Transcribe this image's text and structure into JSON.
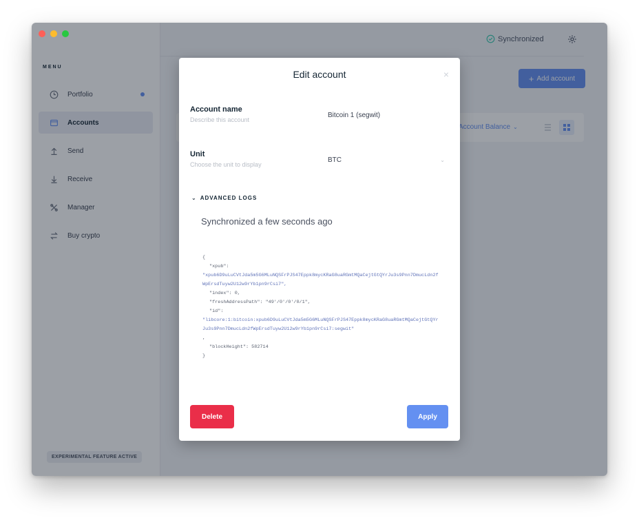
{
  "sidebar": {
    "menu_title": "MENU",
    "items": [
      {
        "label": "Portfolio",
        "icon": "clock-icon"
      },
      {
        "label": "Accounts",
        "icon": "wallet-icon"
      },
      {
        "label": "Send",
        "icon": "arrow-up-icon"
      },
      {
        "label": "Receive",
        "icon": "arrow-down-icon"
      },
      {
        "label": "Manager",
        "icon": "tools-icon"
      },
      {
        "label": "Buy crypto",
        "icon": "exchange-icon"
      }
    ],
    "experimental": "EXPERIMENTAL FEATURE ACTIVE"
  },
  "topbar": {
    "sync_status": "Synchronized"
  },
  "accounts_page": {
    "add_account": "Add account",
    "sort_label": "Account Balance"
  },
  "modal": {
    "title": "Edit account",
    "close": "×",
    "account_name": {
      "label": "Account name",
      "description": "Describe this account",
      "value": "Bitcoin 1 (segwit)"
    },
    "unit": {
      "label": "Unit",
      "description": "Choose the unit to display",
      "value": "BTC"
    },
    "advanced_logs": "ADVANCED LOGS",
    "sync_text": "Synchronized a few seconds ago",
    "log": {
      "open": "{",
      "xpub_key": "\"xpub\":",
      "xpub_value": "\"xpub6D9uLuCVtJda5m5G6MLuNQSFrPJS47Eppk8mycKRaG8uaRGmtMQaCejtGtQYrJu3s9Pnn7DmucLdn2fWpErsdTuyw2U12w9rYb1pn9rCsi7\",",
      "index": "\"index\": 0,",
      "fresh_address_path": "\"freshAddressPath\": \"49'/0'/0'/0/1\",",
      "id_key": "\"id\":",
      "id_value": "\"libcore:1:bitcoin:xpub6D9uLuCVtJda5m5G6MLuNQSFrPJS47Eppk8mycKRaG8uaRGmtMQaCejtGtQYrJu3s9Pnn7DmucLdn2fWpErsdTuyw2U12w9rYb1pn9rCsi7:segwit\"",
      "comma": ",",
      "block_height": "\"blockHeight\": 582714",
      "close": "}"
    },
    "delete_label": "Delete",
    "apply_label": "Apply"
  },
  "colors": {
    "accent": "#6490f1",
    "danger": "#ea2e49",
    "success": "#41ccb4"
  }
}
